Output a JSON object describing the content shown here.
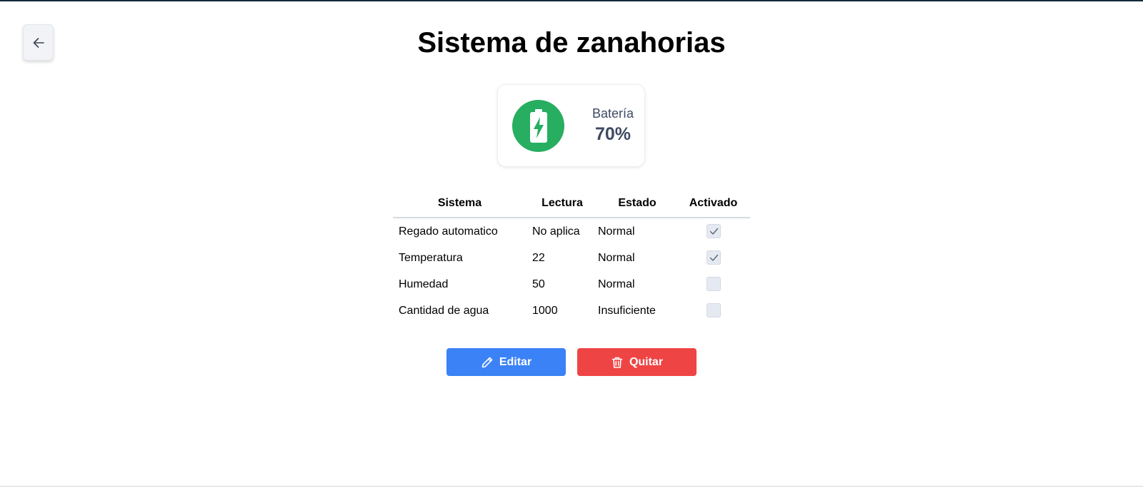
{
  "header": {
    "title": "Sistema de zanahorias",
    "back_icon": "arrow-left-icon"
  },
  "battery": {
    "label": "Batería",
    "value": "70%",
    "level_percent": 70,
    "icon": "battery-charging-icon",
    "color": "#27ae60"
  },
  "table": {
    "headers": [
      "Sistema",
      "Lectura",
      "Estado",
      "Activado"
    ],
    "rows": [
      {
        "sistema": "Regado automatico",
        "lectura": "No aplica",
        "estado": "Normal",
        "activado": true
      },
      {
        "sistema": "Temperatura",
        "lectura": "22",
        "estado": "Normal",
        "activado": true
      },
      {
        "sistema": "Humedad",
        "lectura": "50",
        "estado": "Normal",
        "activado": false
      },
      {
        "sistema": "Cantidad de agua",
        "lectura": "1000",
        "estado": "Insuficiente",
        "activado": false
      }
    ]
  },
  "actions": {
    "edit_label": "Editar",
    "edit_icon": "pencil-icon",
    "edit_color": "#3b82f6",
    "remove_label": "Quitar",
    "remove_icon": "trash-icon",
    "remove_color": "#ef4444"
  }
}
